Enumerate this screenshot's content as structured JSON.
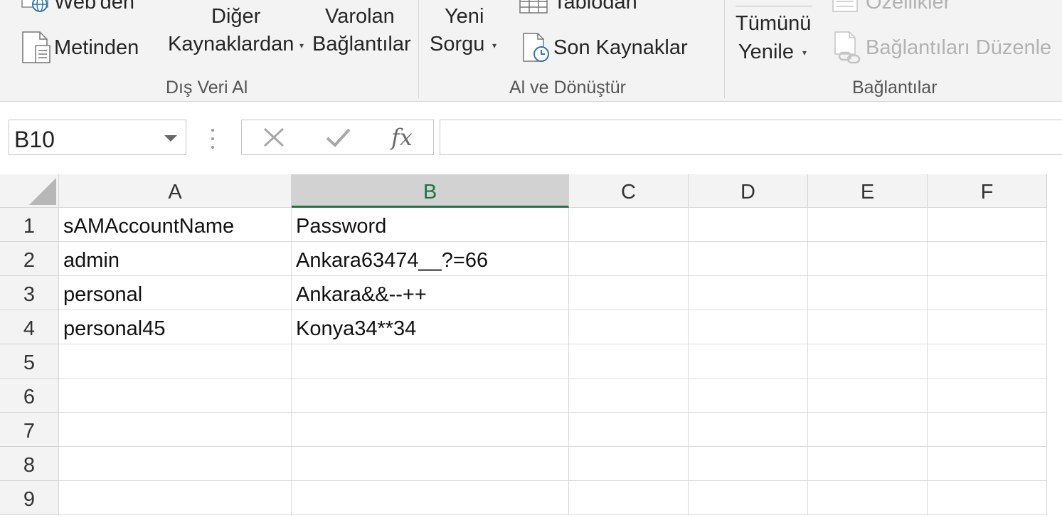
{
  "ribbon": {
    "groups": {
      "dis_veri_al": {
        "label": "Dış Veri Al",
        "web_den": "Web'den",
        "metinden": "Metinden",
        "diger_line1": "Diğer",
        "diger_line2": "Kaynaklardan",
        "varolan_line1": "Varolan",
        "varolan_line2": "Bağlantılar"
      },
      "al_ve_donustur": {
        "label": "Al ve Dönüştür",
        "yeni_line1": "Yeni",
        "yeni_line2": "Sorgu",
        "tablodan": "Tablodan",
        "son_kaynaklar": "Son Kaynaklar"
      },
      "baglantilar": {
        "label": "Bağlantılar",
        "tumunu_line1": "Tümünü",
        "tumunu_line2": "Yenile",
        "ozellikler": "Özellikler",
        "baglantilari_duzenle": "Bağlantıları Düzenle"
      }
    }
  },
  "formula_bar": {
    "name_box": "B10",
    "fx_label": "fx",
    "formula": ""
  },
  "sheet": {
    "columns": [
      "A",
      "B",
      "C",
      "D",
      "E",
      "F"
    ],
    "selected_column": "B",
    "rows": [
      "1",
      "2",
      "3",
      "4",
      "5",
      "6",
      "7",
      "8",
      "9"
    ],
    "cells": [
      [
        "sAMAccountName",
        "Password"
      ],
      [
        "admin",
        "Ankara63474__?=66"
      ],
      [
        "personal",
        "Ankara&&--++"
      ],
      [
        "personal45",
        "Konya34**34"
      ],
      [
        "",
        ""
      ],
      [
        "",
        ""
      ],
      [
        "",
        ""
      ],
      [
        "",
        ""
      ],
      [
        "",
        ""
      ]
    ]
  },
  "colors": {
    "accent": "#217346",
    "ribbon_bg": "#f3f3f3",
    "header_selected_bg": "#d2d2d2"
  }
}
